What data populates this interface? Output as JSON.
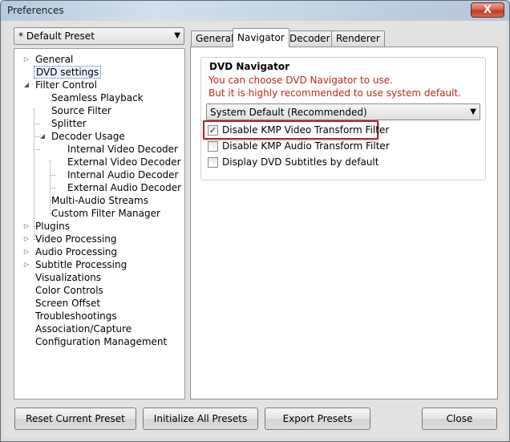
{
  "window": {
    "title": "Preferences",
    "close_label": "X"
  },
  "preset": {
    "value": "* Default Preset"
  },
  "tree": {
    "items": [
      {
        "label": "General",
        "expander": "▷"
      },
      {
        "label": "DVD settings"
      },
      {
        "label": "Filter Control",
        "expander": "◢"
      },
      {
        "label": "Seamless Playback"
      },
      {
        "label": "Source Filter"
      },
      {
        "label": "Splitter"
      },
      {
        "label": "Decoder Usage",
        "expander": "◢"
      },
      {
        "label": "Internal Video Decoder"
      },
      {
        "label": "External Video Decoder"
      },
      {
        "label": "Internal Audio Decoder"
      },
      {
        "label": "External Audio Decoder"
      },
      {
        "label": "Multi-Audio Streams"
      },
      {
        "label": "Custom Filter Manager"
      },
      {
        "label": "Plugins",
        "expander": "▷"
      },
      {
        "label": "Video Processing",
        "expander": "▷"
      },
      {
        "label": "Audio Processing",
        "expander": "▷"
      },
      {
        "label": "Subtitle Processing",
        "expander": "▷"
      },
      {
        "label": "Visualizations"
      },
      {
        "label": "Color Controls"
      },
      {
        "label": "Screen Offset"
      },
      {
        "label": "Troubleshootings"
      },
      {
        "label": "Association/Capture"
      },
      {
        "label": "Configuration Management"
      }
    ]
  },
  "tabs": [
    {
      "label": "General"
    },
    {
      "label": "Navigator"
    },
    {
      "label": "Decoder"
    },
    {
      "label": "Renderer"
    }
  ],
  "navigator": {
    "group_title": "DVD Navigator",
    "note_line1": "You can choose DVD Navigator to use.",
    "note_line2": "But it is highly recommended to use system default.",
    "select_value": "System Default (Recommended)",
    "options": [
      {
        "label": "Disable KMP Video Transform Filter",
        "checked": true
      },
      {
        "label": "Disable KMP Audio Transform Filter",
        "checked": false
      },
      {
        "label": "Display DVD Subtitles by default",
        "checked": false
      }
    ]
  },
  "buttons": {
    "reset": "Reset Current Preset",
    "initialize": "Initialize All Presets",
    "export": "Export Presets",
    "close": "Close"
  },
  "colors": {
    "note_text": "#c0281c",
    "highlight_border": "#a8282a"
  }
}
